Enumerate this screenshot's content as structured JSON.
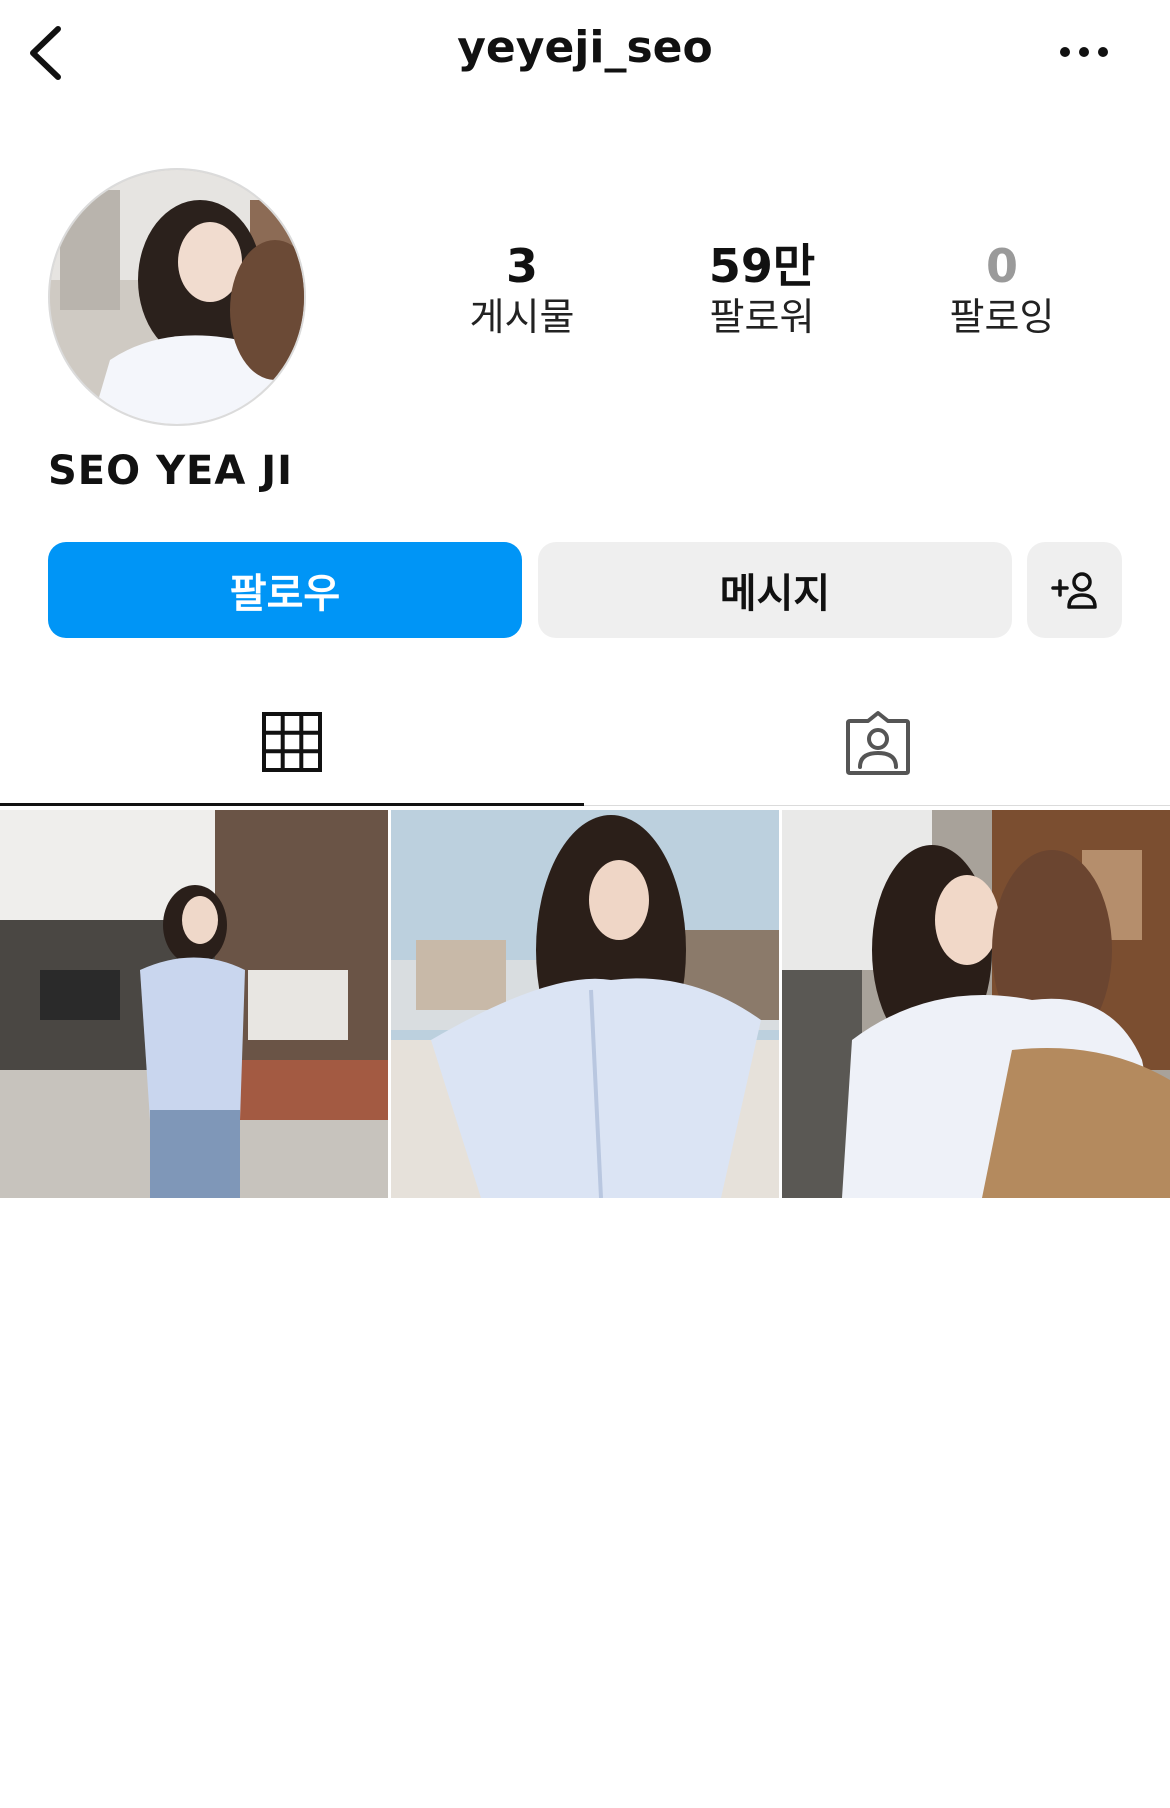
{
  "header": {
    "username": "yeyeji_seo",
    "back_icon": "chevron-left-icon",
    "more_icon": "ellipsis-horizontal-icon"
  },
  "profile": {
    "full_name": "SEO YEA JI",
    "stats": [
      {
        "key": "posts",
        "value": "3",
        "label": "게시물"
      },
      {
        "key": "followers",
        "value": "59만",
        "label": "팔로워"
      },
      {
        "key": "following",
        "value": "0",
        "label": "팔로잉"
      }
    ]
  },
  "actions": {
    "follow_label": "팔로우",
    "message_label": "메시지",
    "suggest_icon": "add-person-icon"
  },
  "tabs": [
    {
      "name": "posts",
      "icon": "grid-icon",
      "active": true
    },
    {
      "name": "tagged",
      "icon": "tagged-person-icon",
      "active": false
    }
  ],
  "posts": [
    {
      "index": 1,
      "description": "photo"
    },
    {
      "index": 2,
      "description": "photo"
    },
    {
      "index": 3,
      "description": "photo"
    }
  ],
  "colors": {
    "accent": "#0095f6",
    "secondary_button": "#efefef",
    "text": "#111111",
    "muted": "#9a9a9a",
    "divider": "#dbdbdb"
  }
}
